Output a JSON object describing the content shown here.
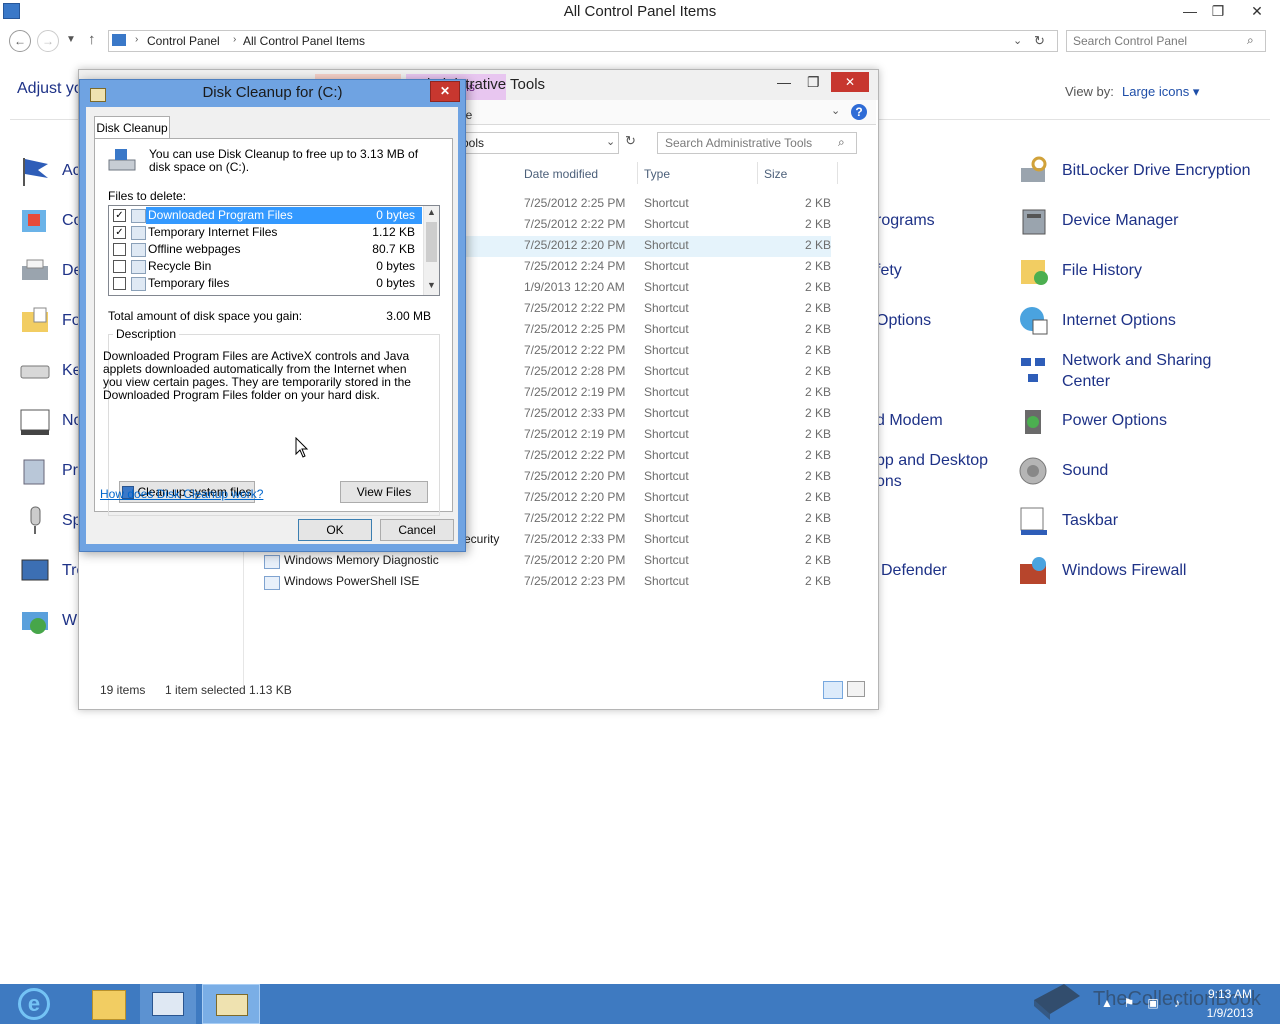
{
  "control_panel": {
    "title": "All Control Panel Items",
    "breadcrumb": [
      "Control Panel",
      "All Control Panel Items"
    ],
    "search_placeholder": "Search Control Panel",
    "adjust_heading": "Adjust yo",
    "view_by_label": "View by:",
    "view_by_value": "Large icons ▾",
    "left_items": [
      "Ac",
      "Co",
      "De",
      "Fo",
      "Ke",
      "No",
      "Pr",
      "Sp",
      "Tro",
      "W"
    ],
    "middle_items": [
      "rograms",
      "fety",
      "Options",
      "d Modem",
      "pp and Desktop",
      "ons",
      "Defender"
    ],
    "right_items": [
      "BitLocker Drive Encryption",
      "Device Manager",
      "File History",
      "Internet Options",
      "Network and Sharing",
      "Center",
      "Power Options",
      "Sound",
      "Taskbar",
      "Windows Firewall"
    ]
  },
  "admin_tools": {
    "title": "Administrative Tools",
    "app_tools_tab": "n Tools",
    "manage_tab": "ge",
    "address_tail": "ools",
    "search_placeholder": "Search Administrative Tools",
    "columns": {
      "date": "Date modified",
      "type": "Type",
      "size": "Size"
    },
    "rows": [
      {
        "date": "7/25/2012 2:25 PM",
        "type": "Shortcut",
        "size": "2 KB"
      },
      {
        "date": "7/25/2012 2:22 PM",
        "type": "Shortcut",
        "size": "2 KB"
      },
      {
        "date": "7/25/2012 2:20 PM",
        "type": "Shortcut",
        "size": "2 KB"
      },
      {
        "date": "7/25/2012 2:24 PM",
        "type": "Shortcut",
        "size": "2 KB"
      },
      {
        "date": "1/9/2013 12:20 AM",
        "type": "Shortcut",
        "size": "2 KB"
      },
      {
        "date": "7/25/2012 2:22 PM",
        "type": "Shortcut",
        "size": "2 KB"
      },
      {
        "date": "7/25/2012 2:25 PM",
        "type": "Shortcut",
        "size": "2 KB"
      },
      {
        "date": "7/25/2012 2:22 PM",
        "type": "Shortcut",
        "size": "2 KB"
      },
      {
        "date": "7/25/2012 2:28 PM",
        "type": "Shortcut",
        "size": "2 KB"
      },
      {
        "date": "7/25/2012 2:19 PM",
        "type": "Shortcut",
        "size": "2 KB"
      },
      {
        "date": "7/25/2012 2:33 PM",
        "type": "Shortcut",
        "size": "2 KB"
      },
      {
        "date": "7/25/2012 2:19 PM",
        "type": "Shortcut",
        "size": "2 KB"
      },
      {
        "date": "7/25/2012 2:22 PM",
        "type": "Shortcut",
        "size": "2 KB"
      },
      {
        "date": "7/25/2012 2:20 PM",
        "type": "Shortcut",
        "size": "2 KB"
      },
      {
        "date": "7/25/2012 2:20 PM",
        "type": "Shortcut",
        "size": "2 KB"
      },
      {
        "date": "7/25/2012 2:22 PM",
        "type": "Shortcut",
        "size": "2 KB"
      },
      {
        "date": "7/25/2012 2:33 PM",
        "type": "Shortcut",
        "size": "2 KB",
        "name": "ecurity"
      },
      {
        "date": "7/25/2012 2:20 PM",
        "type": "Shortcut",
        "size": "2 KB",
        "name": "Windows Memory Diagnostic"
      },
      {
        "date": "7/25/2012 2:23 PM",
        "type": "Shortcut",
        "size": "2 KB",
        "name": "Windows PowerShell ISE"
      }
    ],
    "status_items": "19 items",
    "status_selected": "1 item selected  1.13 KB"
  },
  "disk_cleanup": {
    "title": "Disk Cleanup for  (C:)",
    "tab": "Disk Cleanup",
    "intro": "You can use Disk Cleanup to free up to 3.13 MB of disk space on  (C:).",
    "files_label": "Files to delete:",
    "items": [
      {
        "name": "Downloaded Program Files",
        "size": "0 bytes",
        "checked": true
      },
      {
        "name": "Temporary Internet Files",
        "size": "1.12 KB",
        "checked": true
      },
      {
        "name": "Offline webpages",
        "size": "80.7 KB",
        "checked": false
      },
      {
        "name": "Recycle Bin",
        "size": "0 bytes",
        "checked": false
      },
      {
        "name": "Temporary files",
        "size": "0 bytes",
        "checked": false
      }
    ],
    "total_label": "Total amount of disk space you gain:",
    "total_value": "3.00 MB",
    "description_legend": "Description",
    "description": "Downloaded Program Files are ActiveX controls and Java applets downloaded automatically from the Internet when you view certain pages. They are temporarily stored in the Downloaded Program Files folder on your hard disk.",
    "cleanup_button": "Clean up system files",
    "view_files_button": "View Files",
    "help_link": "How does Disk Cleanup work?",
    "ok": "OK",
    "cancel": "Cancel",
    "close_glyph": "✕"
  },
  "taskbar": {
    "time": "9:13 AM",
    "date": "1/9/2013",
    "watermark": "TheCollectionBook"
  },
  "colors": {
    "accent": "#3e7ac1",
    "link": "#1e3287",
    "selection": "#3399ff"
  }
}
